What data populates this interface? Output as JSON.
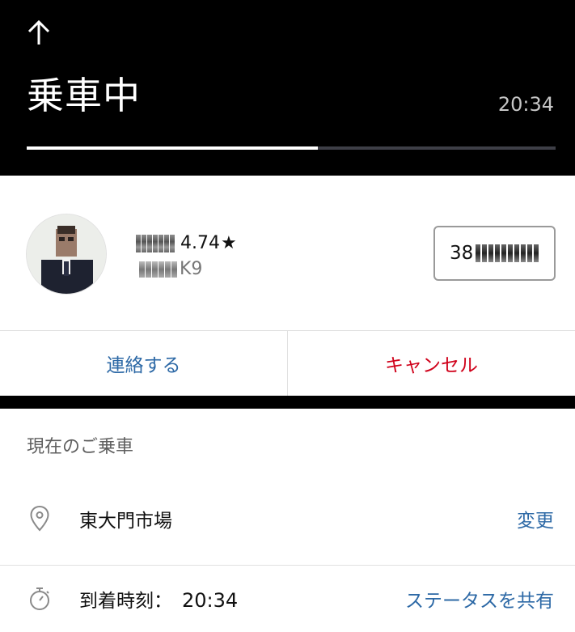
{
  "header": {
    "back_icon": "arrow-up-icon",
    "title": "乗車中",
    "time": "20:34",
    "progress": 0.55
  },
  "driver": {
    "avatar_icon": "driver-photo",
    "rating": "4.74",
    "star": "★",
    "vehicle_suffix": "K9",
    "plate_prefix": "38"
  },
  "actions": {
    "contact_label": "連絡する",
    "cancel_label": "キャンセル"
  },
  "trip": {
    "section_label": "現在のご乗車",
    "pickup_icon": "location-pin-icon",
    "pickup_place": "東大門市場",
    "change_label": "変更",
    "timer_icon": "stopwatch-icon",
    "arrival_label": "到着時刻：",
    "arrival_time": "20:34",
    "share_label": "ステータスを共有"
  },
  "colors": {
    "header_bg": "#000000",
    "link_blue": "#2d69a6",
    "cancel_red": "#d0021b"
  }
}
